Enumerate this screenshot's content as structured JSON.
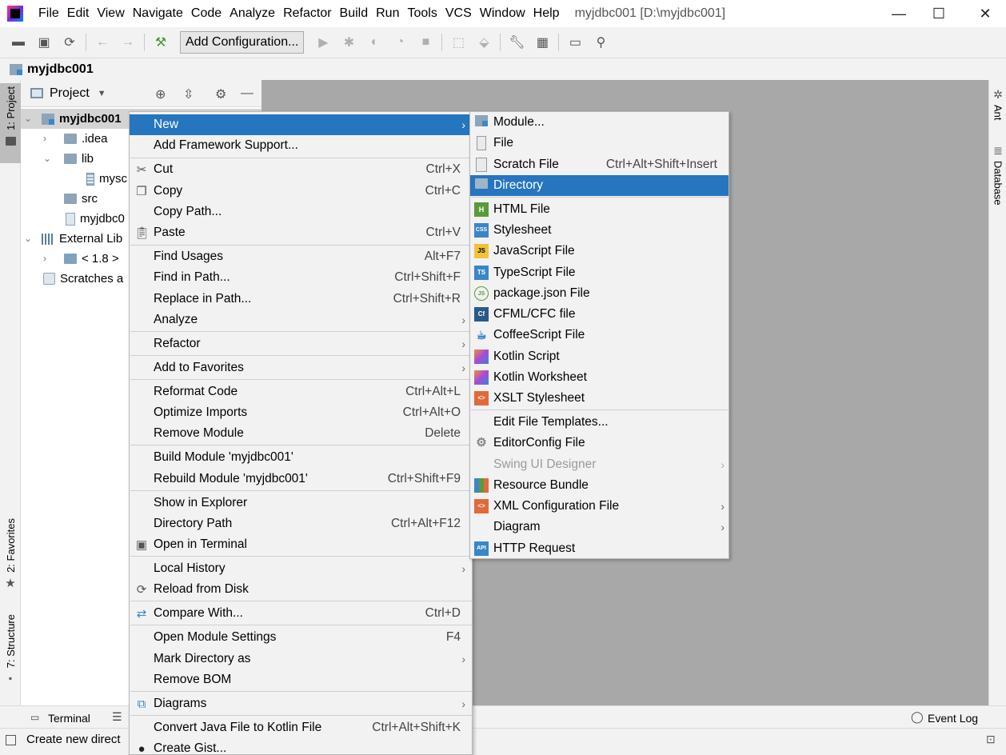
{
  "menubar": {
    "items": [
      "File",
      "Edit",
      "View",
      "Navigate",
      "Code",
      "Analyze",
      "Refactor",
      "Build",
      "Run",
      "Tools",
      "VCS",
      "Window",
      "Help"
    ],
    "window_title": "myjdbc001 [D:\\myjdbc001]",
    "minimize": "—",
    "maximize": "☐",
    "close": "✕"
  },
  "toolbar": {
    "add_configuration": "Add Configuration..."
  },
  "navbar": {
    "project": "myjdbc001"
  },
  "left_strip": {
    "project_tab": "1: Project",
    "favorites_tab": "2: Favorites",
    "structure_tab": "7: Structure"
  },
  "right_strip": {
    "ant_tab": "Ant",
    "database_tab": "Database"
  },
  "project_panel": {
    "title": "Project",
    "tree": {
      "root": "myjdbc001",
      "idea": ".idea",
      "lib": "lib",
      "jar": "mysc",
      "src": "src",
      "iml": "myjdbc0",
      "external": "External Lib",
      "jdk": "< 1.8 >",
      "scratches": "Scratches a"
    }
  },
  "bottom": {
    "terminal": "Terminal",
    "event_log": "Event Log",
    "status": "Create new direct"
  },
  "context_menu": {
    "new": "New",
    "add_framework": "Add Framework Support...",
    "cut": "Cut",
    "cut_sc": "Ctrl+X",
    "copy": "Copy",
    "copy_sc": "Ctrl+C",
    "copy_path": "Copy Path...",
    "paste": "Paste",
    "paste_sc": "Ctrl+V",
    "find_usages": "Find Usages",
    "find_usages_sc": "Alt+F7",
    "find_in_path": "Find in Path...",
    "find_in_path_sc": "Ctrl+Shift+F",
    "replace_in_path": "Replace in Path...",
    "replace_in_path_sc": "Ctrl+Shift+R",
    "analyze": "Analyze",
    "refactor": "Refactor",
    "add_to_favorites": "Add to Favorites",
    "reformat_code": "Reformat Code",
    "reformat_code_sc": "Ctrl+Alt+L",
    "optimize_imports": "Optimize Imports",
    "optimize_imports_sc": "Ctrl+Alt+O",
    "remove_module": "Remove Module",
    "remove_module_sc": "Delete",
    "build_module": "Build Module 'myjdbc001'",
    "rebuild_module": "Rebuild Module 'myjdbc001'",
    "rebuild_module_sc": "Ctrl+Shift+F9",
    "show_in_explorer": "Show in Explorer",
    "directory_path": "Directory Path",
    "directory_path_sc": "Ctrl+Alt+F12",
    "open_in_terminal": "Open in Terminal",
    "local_history": "Local History",
    "reload_from_disk": "Reload from Disk",
    "compare_with": "Compare With...",
    "compare_with_sc": "Ctrl+D",
    "open_module_settings": "Open Module Settings",
    "open_module_settings_sc": "F4",
    "mark_directory_as": "Mark Directory as",
    "remove_bom": "Remove BOM",
    "diagrams": "Diagrams",
    "convert_java": "Convert Java File to Kotlin File",
    "convert_java_sc": "Ctrl+Alt+Shift+K",
    "create_gist": "Create Gist..."
  },
  "new_submenu": {
    "module": "Module...",
    "file": "File",
    "scratch_file": "Scratch File",
    "scratch_file_sc": "Ctrl+Alt+Shift+Insert",
    "directory": "Directory",
    "html_file": "HTML File",
    "stylesheet": "Stylesheet",
    "javascript_file": "JavaScript File",
    "typescript_file": "TypeScript File",
    "package_json": "package.json File",
    "cfml": "CFML/CFC file",
    "coffeescript": "CoffeeScript File",
    "kotlin_script": "Kotlin Script",
    "kotlin_worksheet": "Kotlin Worksheet",
    "xslt": "XSLT Stylesheet",
    "edit_templates": "Edit File Templates...",
    "editorconfig": "EditorConfig File",
    "swing_ui": "Swing UI Designer",
    "resource_bundle": "Resource Bundle",
    "xml_config": "XML Configuration File",
    "diagram": "Diagram",
    "http_request": "HTTP Request",
    "icon_labels": {
      "h": "H",
      "css": "CSS",
      "js": "JS",
      "ts": "TS",
      "cf": "Cf",
      "xml": "<>",
      "api": "API",
      "json": "JS"
    }
  },
  "colors": {
    "selection": "#2675bf",
    "editor_bg": "#a8a8a8",
    "chrome": "#f2f2f2"
  }
}
